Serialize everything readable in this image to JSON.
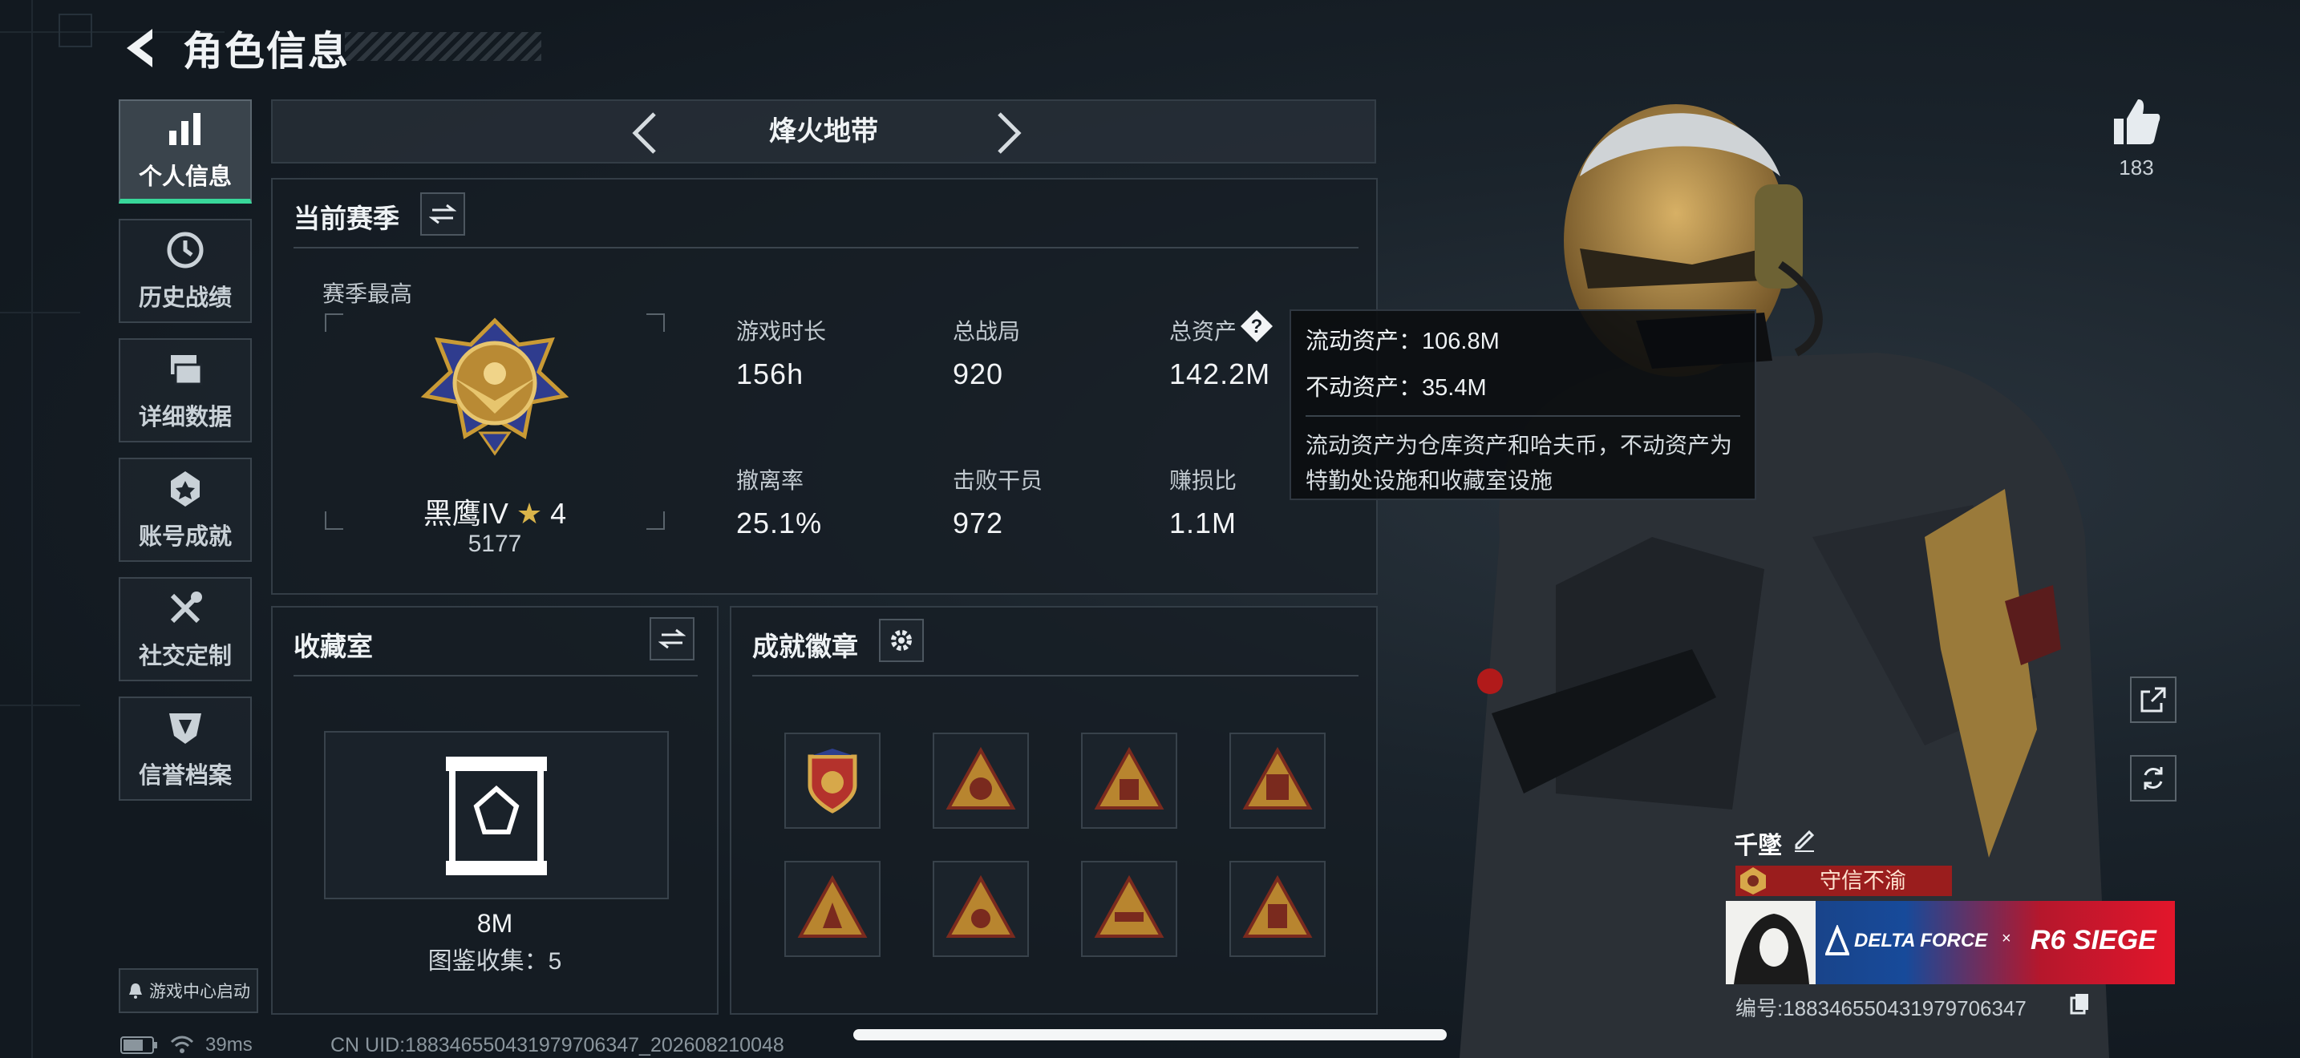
{
  "header": {
    "title": "角色信息"
  },
  "sidebar": {
    "items": [
      {
        "label": "个人信息",
        "active": true,
        "icon": "bar-chart-icon"
      },
      {
        "label": "历史战绩",
        "icon": "history-icon"
      },
      {
        "label": "详细数据",
        "icon": "folders-icon"
      },
      {
        "label": "账号成就",
        "icon": "medal-icon"
      },
      {
        "label": "社交定制",
        "icon": "tools-icon"
      },
      {
        "label": "信誉档案",
        "icon": "shield-icon"
      }
    ],
    "game_center": "游戏中心启动"
  },
  "mode": {
    "title": "烽火地带"
  },
  "season": {
    "title": "当前赛季",
    "best_label": "赛季最高",
    "rank_name": "黑鹰IV",
    "rank_stars": "4",
    "rank_score": "5177",
    "stats": [
      {
        "label": "游戏时长",
        "value": "156h"
      },
      {
        "label": "总战局",
        "value": "920"
      },
      {
        "label": "总资产",
        "value": "142.2M"
      },
      {
        "label": "撤离率",
        "value": "25.1%"
      },
      {
        "label": "击败干员",
        "value": "972"
      },
      {
        "label": "赚损比",
        "value": "1.1M"
      }
    ]
  },
  "tooltip": {
    "liquid": "流动资产：106.8M",
    "fixed": "不动资产：35.4M",
    "description": "流动资产为仓库资产和哈夫币，不动资产为特勤处设施和收藏室设施"
  },
  "collection": {
    "title": "收藏室",
    "value": "8M",
    "count": "图鉴收集：5"
  },
  "badges": {
    "title": "成就徽章"
  },
  "profile": {
    "likes": "183",
    "name": "千墜",
    "title": "守信不渝",
    "banner_left": "DELTA FORCE",
    "banner_x": "×",
    "banner_right": "R6 SIEGE",
    "player_id": "编号:1883465504319797063​47"
  },
  "status_bar": {
    "ping": "39ms",
    "uid": "CN UID:18834655043197970634​7_20260821004​8"
  },
  "colors": {
    "accent": "#38d79a",
    "title_red": "#9a1d1d",
    "gold": "#c99a35"
  }
}
